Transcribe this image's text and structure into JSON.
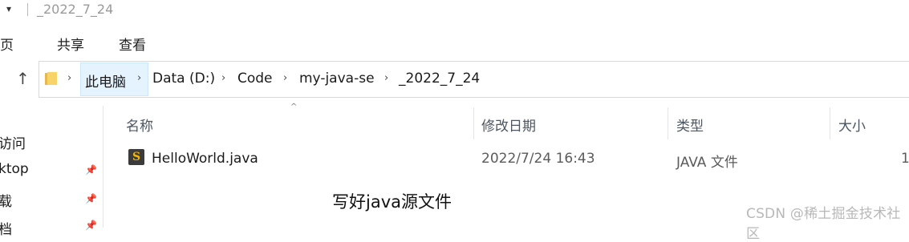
{
  "window": {
    "quick_access_arrow": "▾",
    "title": "_2022_7_24"
  },
  "ribbon": {
    "tabs": [
      "主页",
      "共享",
      "查看"
    ],
    "home_visible_fragment": "主页"
  },
  "nav": {
    "up_arrow": "↑",
    "breadcrumb": [
      "此电脑",
      "Data (D:)",
      "Code",
      "my-java-se",
      "_2022_7_24"
    ],
    "separator": "›"
  },
  "left_pane": {
    "items": [
      {
        "label": "访问",
        "pinned": false
      },
      {
        "label": "ktop",
        "pinned": true
      },
      {
        "label": "载",
        "pinned": true
      },
      {
        "label": "档",
        "pinned": true
      }
    ],
    "pin_glyph": "📌"
  },
  "columns": {
    "name": "名称",
    "modified": "修改日期",
    "type": "类型",
    "size": "大小"
  },
  "files": [
    {
      "name": "HelloWorld.java",
      "modified": "2022/7/24 16:43",
      "type": "JAVA 文件",
      "size": "1",
      "icon": "sublime-file-icon"
    }
  ],
  "annotation": "写好java源文件",
  "watermark": "CSDN @稀土掘金技术社区",
  "colors": {
    "selection_bg": "#e5f3ff",
    "selection_border": "#cce8ff",
    "icon_accent": "#f4b400"
  }
}
